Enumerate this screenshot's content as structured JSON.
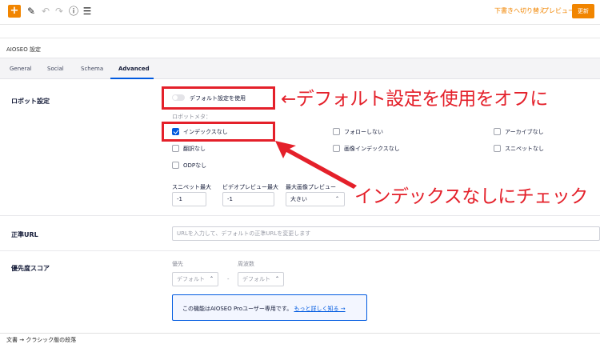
{
  "toolbar": {
    "add_icon": "plus-icon",
    "draft_link": "下書きへ切り替え",
    "preview_link": "プレビュー",
    "update_button": "更新"
  },
  "panel": {
    "title": "AIOSEO 設定",
    "tabs": [
      {
        "label": "General",
        "active": false
      },
      {
        "label": "Social",
        "active": false
      },
      {
        "label": "Schema",
        "active": false
      },
      {
        "label": "Advanced",
        "active": true
      }
    ]
  },
  "robots": {
    "section_label": "ロボット設定",
    "default_toggle_label": "デフォルト設定を使用",
    "default_toggle_on": false,
    "meta_label": "ロボットメタ：",
    "checkboxes": [
      {
        "label": "インデックスなし",
        "checked": true
      },
      {
        "label": "フォローしない",
        "checked": false
      },
      {
        "label": "アーカイブなし",
        "checked": false
      },
      {
        "label": "翻訳なし",
        "checked": false
      },
      {
        "label": "画像インデックスなし",
        "checked": false
      },
      {
        "label": "スニペットなし",
        "checked": false
      },
      {
        "label": "ODPなし",
        "checked": false
      }
    ],
    "snippet_max_label": "スニペット最大",
    "snippet_max_value": "-1",
    "video_preview_label": "ビデオプレビュー最大",
    "video_preview_value": "-1",
    "image_preview_label": "最大画像プレビュー",
    "image_preview_value": "大きい"
  },
  "canonical": {
    "section_label": "正準URL",
    "placeholder": "URLを入力して、デフォルトの正準URLを変更します"
  },
  "priority": {
    "section_label": "優先度スコア",
    "priority_label": "優先",
    "priority_value": "デフォルト",
    "separator": "-",
    "frequency_label": "周波数",
    "frequency_value": "デフォルト",
    "pro_notice": "この機能はAIOSEO Proユーザー専用です。",
    "pro_link": "もっと詳しく知る →"
  },
  "footer": {
    "breadcrumb": "文書 → クラシック版の段落"
  },
  "annotations": {
    "top_text": "←デフォルト設定を使用をオフに",
    "bottom_text": "インデックスなしにチェック",
    "color": "#e4202a"
  },
  "colors": {
    "accent": "#f18500",
    "primary": "#005ae0"
  }
}
